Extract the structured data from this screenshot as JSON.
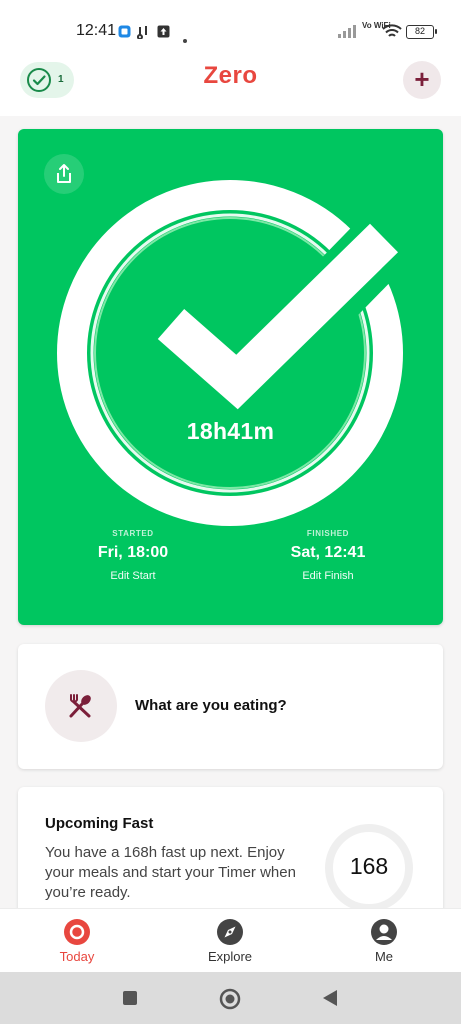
{
  "status_bar": {
    "time": "12:41",
    "network_label": "Vo WiFi",
    "battery": "82"
  },
  "header": {
    "title": "Zero",
    "streak_count": "1",
    "add_label": "+"
  },
  "timer_card": {
    "elapsed": "18h41m",
    "progress": 1.0,
    "status_icon": "check-icon",
    "started": {
      "label": "STARTED",
      "value": "Fri, 18:00",
      "edit": "Edit Start"
    },
    "finished": {
      "label": "FINISHED",
      "value": "Sat, 12:41",
      "edit": "Edit Finish"
    },
    "card_color": "#00c660"
  },
  "eating_card": {
    "prompt": "What are you eating?",
    "icon": "fork-spoon-icon",
    "icon_color": "#7b1f3a"
  },
  "upcoming_fast": {
    "title": "Upcoming Fast",
    "description": "You have a 168h fast up next. Enjoy your meals and start your Timer when you’re ready.",
    "hours": "168"
  },
  "bottom_nav": {
    "items": [
      {
        "label": "Today",
        "icon": "today-icon",
        "active": true
      },
      {
        "label": "Explore",
        "icon": "compass-icon",
        "active": false
      },
      {
        "label": "Me",
        "icon": "profile-icon",
        "active": false
      }
    ]
  },
  "colors": {
    "accent": "#e8473f",
    "brand_green": "#00c660",
    "maroon": "#7b1f3a"
  }
}
